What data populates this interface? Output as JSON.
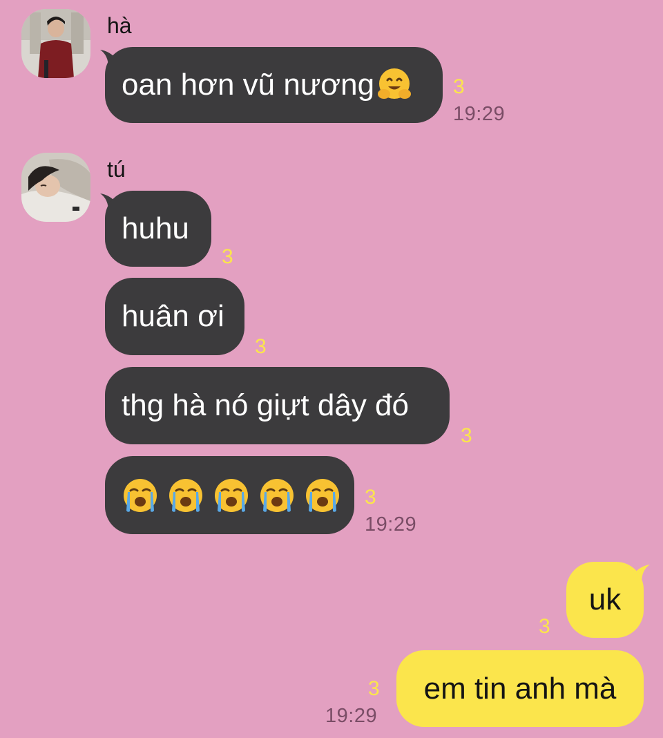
{
  "messages": [
    {
      "sender": "hà",
      "avatar_icon": "user-photo-icon",
      "bubbles": [
        {
          "text": "oan hơn vũ nương",
          "emoji": "hugging-face-emoji",
          "unread": "3",
          "time": "19:29"
        }
      ]
    },
    {
      "sender": "tú",
      "avatar_icon": "user-photo-icon",
      "bubbles": [
        {
          "text": "huhu",
          "unread": "3"
        },
        {
          "text": "huân ơi",
          "unread": "3"
        },
        {
          "text": "thg hà nó giựt dây đó",
          "unread": "3"
        },
        {
          "emojis": [
            "loudly-crying-face-emoji",
            "loudly-crying-face-emoji",
            "loudly-crying-face-emoji",
            "loudly-crying-face-emoji",
            "loudly-crying-face-emoji"
          ],
          "unread": "3",
          "time": "19:29"
        }
      ]
    },
    {
      "sender": "me",
      "bubbles": [
        {
          "text": "uk",
          "unread": "3"
        },
        {
          "text": "em tin anh mà",
          "unread": "3",
          "time": "19:29"
        }
      ]
    }
  ],
  "colors": {
    "background": "#e3a0c1",
    "incoming_bubble": "#3c3b3d",
    "outgoing_bubble": "#fbe54c",
    "unread_count": "#fbe54c",
    "timestamp": "#7a4d66"
  }
}
